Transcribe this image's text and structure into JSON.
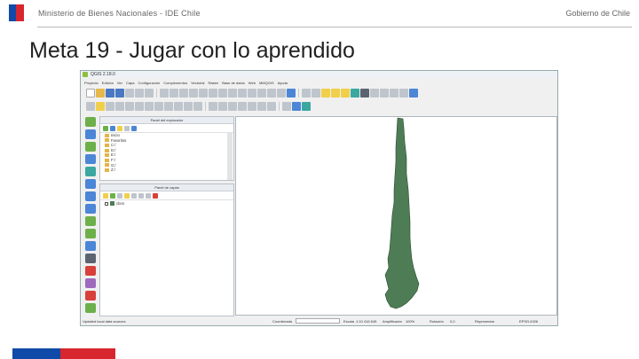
{
  "header": {
    "left_text": "Ministerio de Bienes Nacionales - IDE Chile",
    "right_text": "Gobierno de Chile"
  },
  "slide_title": "Meta 19 - Jugar con lo aprendido",
  "qgis": {
    "title": "QGIS 2.18.0",
    "menu": [
      "Proyecto",
      "Edición",
      "Ver",
      "Capa",
      "Configuración",
      "Complementos",
      "Vectorial",
      "Ráster",
      "Base de datos",
      "Web",
      "MMQGIS",
      "Ayuda"
    ],
    "browser_panel": {
      "title": "Panel del explorador",
      "items": [
        "Inicio",
        "Favoritos",
        "C:/",
        "D:/",
        "E:/",
        "F:/",
        "G:/",
        "Z:/"
      ]
    },
    "layers_panel": {
      "title": "Panel de capas",
      "layers": [
        "cbon"
      ]
    },
    "status_bar": {
      "coordinate_label": "Coordenada",
      "scale_label": "Escala",
      "scale_value": "1:10 416 645",
      "magnifier_label": "Amplificador",
      "magnifier_value": "100%",
      "rotation_label": "Rotación",
      "rotation_value": "0,0",
      "render_label": "Representar",
      "crs_value": "EPSG:4326",
      "message": "Updated local data sources"
    },
    "colors": {
      "map_fill": "#4e7d55",
      "map_stroke": "#2c4a32"
    }
  }
}
